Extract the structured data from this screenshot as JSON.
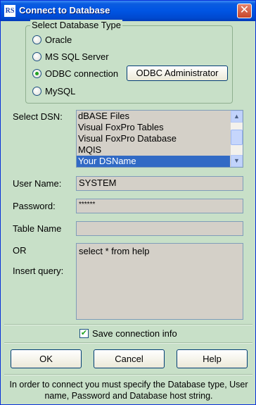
{
  "window": {
    "icon_text": "RS",
    "title": "Connect to  Database",
    "close_glyph": "✕"
  },
  "db_type": {
    "legend": "Select Database Type",
    "options": [
      {
        "label": "Oracle",
        "checked": false
      },
      {
        "label": "MS SQL Server",
        "checked": false
      },
      {
        "label": "ODBC connection",
        "checked": true
      },
      {
        "label": "MySQL",
        "checked": false
      }
    ],
    "odbc_admin_label": "ODBC Administrator"
  },
  "dsn": {
    "label": "Select DSN:",
    "items": [
      "dBASE Files",
      "Visual FoxPro Tables",
      "Visual FoxPro Database",
      "MQIS",
      "Your DSName"
    ],
    "selected": "Your DSName"
  },
  "user_name": {
    "label": "User Name:",
    "value": "SYSTEM"
  },
  "password": {
    "label": "Password:",
    "value": "******"
  },
  "table_name": {
    "label": "Table Name",
    "value": ""
  },
  "query": {
    "or_label": "OR",
    "label": "Insert query:",
    "value": "select * from help"
  },
  "save_info": {
    "label": "Save connection info",
    "checked": true
  },
  "buttons": {
    "ok": "OK",
    "cancel": "Cancel",
    "help": "Help"
  },
  "hint": "In order to connect you must specify the Database type, User name, Password and Database host string.",
  "icons": {
    "close": "close-icon",
    "app": "app-icon",
    "scroll_up": "arrow-up-icon",
    "scroll_down": "arrow-down-icon",
    "check": "checkmark-icon"
  },
  "colors": {
    "titlebar": "#0054e3",
    "dialog_bg": "#c8e0c8",
    "field_bg": "#d4d0c8",
    "selection": "#316ac5",
    "radio_dot": "#21a121"
  }
}
